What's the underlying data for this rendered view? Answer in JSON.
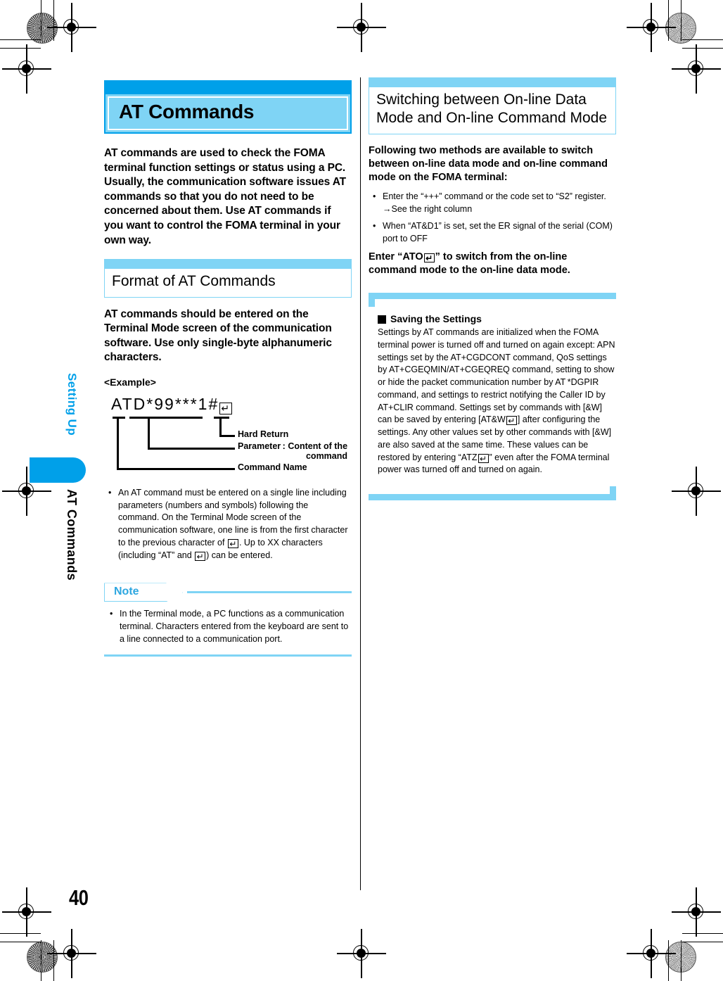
{
  "sidebar": {
    "chapter_label": "Setting Up",
    "section_label": "AT Commands"
  },
  "page_number": "40",
  "left_column": {
    "chapter_title": "AT Commands",
    "intro": "AT commands are used to check the FOMA terminal function settings or status using a PC. Usually, the communication software issues AT commands so that you do not need to be concerned about them. Use AT commands if you want to control the FOMA terminal in your own way.",
    "section_heading": "Format of AT Commands",
    "section_intro": "AT commands should be entered on the Terminal Mode screen of the communication software. Use only single-byte alphanumeric characters.",
    "example_label": "<Example>",
    "example": {
      "command_line": "ATD*99***1#",
      "label_hard_return": "Hard Return",
      "label_parameter": "Parameter :",
      "label_parameter_cont1": "Content of the",
      "label_parameter_cont2": "command",
      "label_command_name": "Command Name"
    },
    "bullet_1_part1": "An AT command must be entered on a single line including parameters (numbers and symbols) following the command. On the Terminal Mode screen of the communication software, one line is from the first character to the previous character of ",
    "bullet_1_part2": ". Up to XX characters (including “AT” and ",
    "bullet_1_part3": ") can be entered.",
    "note": {
      "badge": "Note",
      "bullet": "In the Terminal mode, a PC functions as a communication terminal. Characters entered from the keyboard are sent to a line connected to a communication port."
    }
  },
  "right_column": {
    "section_heading": "Switching between On-line Data Mode and On-line Command Mode",
    "lead": "Following two methods are available to switch between on-line data mode and on-line command mode on the FOMA terminal:",
    "bullet_1": "Enter the “+++” command or the code set to “S2” register.",
    "bullet_1_sub": "→See the right column",
    "bullet_2": "When “AT&D1” is set, set the ER signal of the serial (COM) port to OFF",
    "closing_part1": "Enter “ATO",
    "closing_part2": "” to switch from the on-line command mode to the on-line data mode.",
    "subsection": {
      "title": "Saving the Settings",
      "body_part1": "Settings by AT commands are initialized when the FOMA terminal power is turned off and turned on again except: APN settings set by the AT+CGDCONT command, QoS settings by AT+CGEQMIN/AT+CGEQREQ command, setting to show or hide the packet communication number by AT *DGPIR command, and settings to restrict notifying the Caller ID by AT+CLIR command. Settings set by commands with [&W] can be saved by entering [AT&W",
      "body_part2": "] after configuring the settings. Any other values set by other commands with [&W] are also saved at the same time. These values can be restored by entering “ATZ",
      "body_part3": "” even after the FOMA terminal power was turned off and turned on again."
    }
  },
  "colors": {
    "accent_dark": "#00A0E9",
    "accent_light": "#7FD4F5"
  }
}
